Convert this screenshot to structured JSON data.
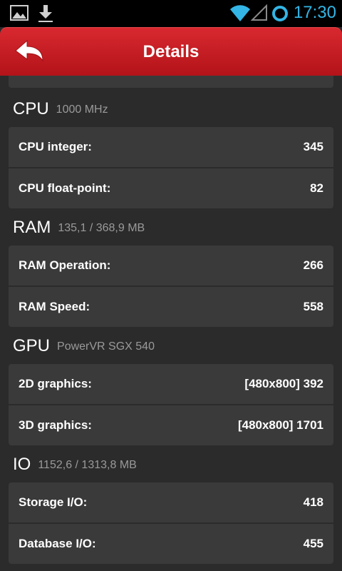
{
  "status_bar": {
    "time": "17:30",
    "icons": [
      "picture-icon",
      "download-icon",
      "wifi-icon",
      "signal-icon",
      "sync-icon"
    ]
  },
  "action_bar": {
    "title": "Details",
    "back_icon": "back-arrow-icon"
  },
  "sections": [
    {
      "title": "CPU",
      "subtitle": "1000 MHz",
      "rows": [
        {
          "label": "CPU integer:",
          "value": "345"
        },
        {
          "label": "CPU float-point:",
          "value": "82"
        }
      ]
    },
    {
      "title": "RAM",
      "subtitle": "135,1 / 368,9 MB",
      "rows": [
        {
          "label": "RAM Operation:",
          "value": "266"
        },
        {
          "label": "RAM Speed:",
          "value": "558"
        }
      ]
    },
    {
      "title": "GPU",
      "subtitle": "PowerVR SGX 540",
      "rows": [
        {
          "label": "2D graphics:",
          "value": "[480x800] 392"
        },
        {
          "label": "3D graphics:",
          "value": "[480x800] 1701"
        }
      ]
    },
    {
      "title": "IO",
      "subtitle": "1152,6 / 1313,8 MB",
      "rows": [
        {
          "label": "Storage I/O:",
          "value": "418"
        },
        {
          "label": "Database I/O:",
          "value": "455"
        }
      ]
    }
  ],
  "colors": {
    "accent": "#33b5e5",
    "action_bar": "#c41c22",
    "background": "#2b2b2b",
    "card": "#3a3a3a"
  }
}
